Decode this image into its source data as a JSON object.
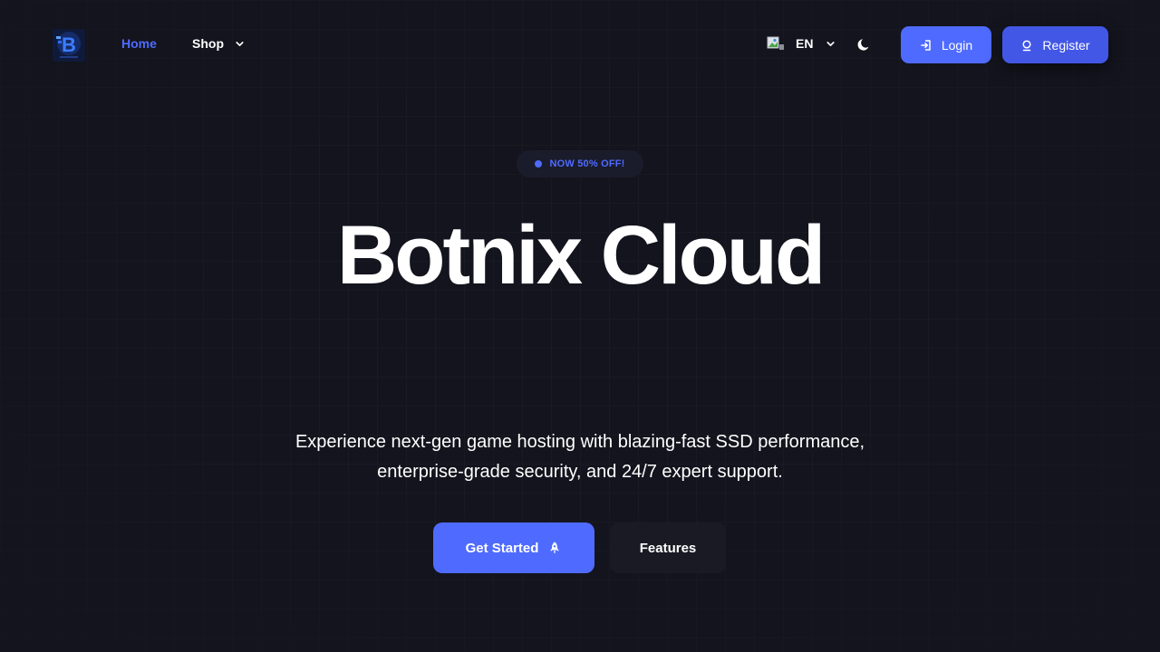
{
  "nav": {
    "logo_icon": "botnix-logo-icon",
    "home_label": "Home",
    "shop_label": "Shop",
    "language_code": "EN",
    "language_flag_icon": "broken-flag-image-icon",
    "theme_icon": "moon-icon",
    "login_label": "Login",
    "login_icon": "login-arrow-icon",
    "register_label": "Register",
    "register_icon": "user-icon"
  },
  "hero": {
    "badge_text": "NOW 50% OFF!",
    "title": "Botnix Cloud",
    "description_line1": "Experience next-gen game hosting with blazing-fast SSD performance,",
    "description_line2": "enterprise-grade security, and 24/7 expert support.",
    "get_started_label": "Get Started",
    "get_started_icon": "rocket-icon",
    "features_label": "Features"
  },
  "colors": {
    "background": "#13141d",
    "accent": "#4f6bff",
    "register_button": "#4257e6",
    "features_button": "#191a23",
    "badge_background": "#1a1c2b"
  }
}
